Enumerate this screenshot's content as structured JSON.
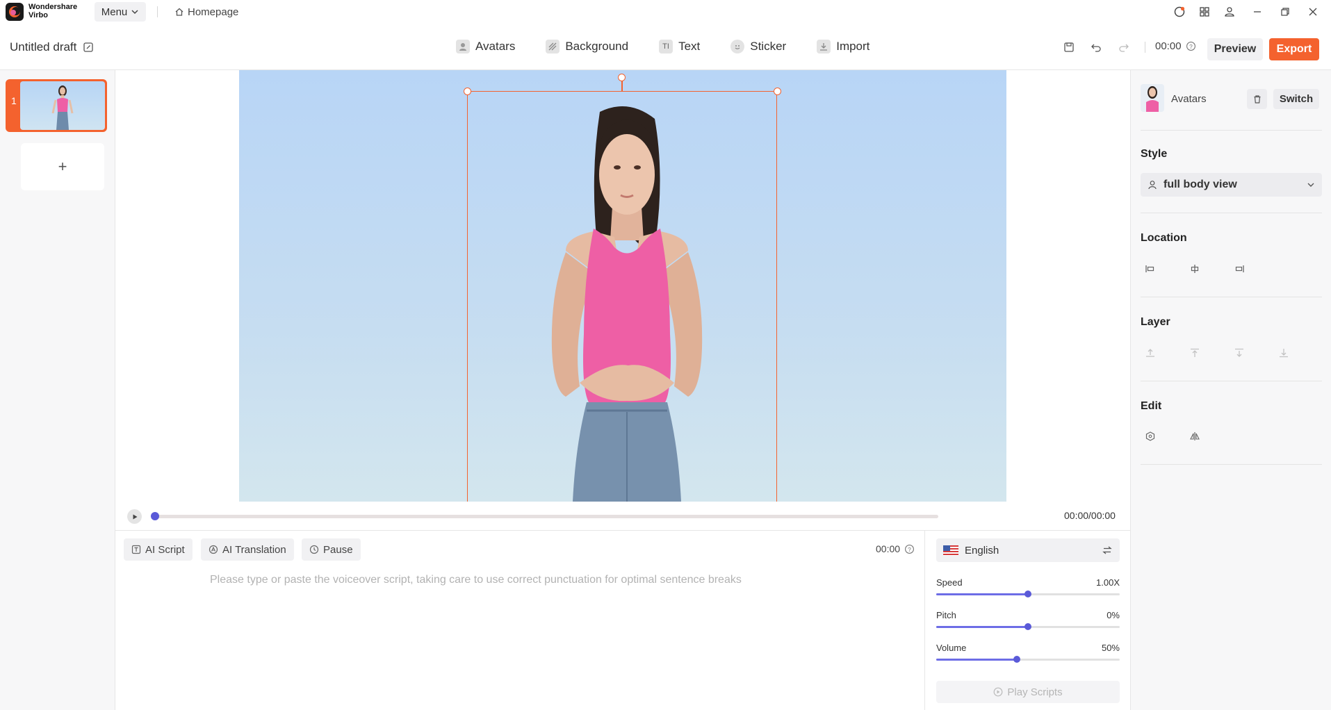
{
  "app": {
    "brand_line1": "Wondershare",
    "brand_line2": "Virbo",
    "menu_label": "Menu",
    "homepage_label": "Homepage"
  },
  "toolbar": {
    "draft_title": "Untitled draft",
    "tools": [
      {
        "label": "Avatars",
        "icon": "avatar-icon"
      },
      {
        "label": "Background",
        "icon": "background-icon"
      },
      {
        "label": "Text",
        "icon": "text-icon",
        "glyph": "TI"
      },
      {
        "label": "Sticker",
        "icon": "sticker-icon"
      },
      {
        "label": "Import",
        "icon": "import-icon"
      }
    ],
    "time": "00:00",
    "preview_label": "Preview",
    "export_label": "Export",
    "accent_color": "#f4622e"
  },
  "scenes": {
    "items": [
      {
        "number": "1",
        "selected": true
      }
    ],
    "add_label": "+"
  },
  "timeline": {
    "time_display": "00:00/00:00",
    "progress": 0
  },
  "script": {
    "ai_script_label": "AI Script",
    "ai_translation_label": "AI Translation",
    "pause_label": "Pause",
    "time": "00:00",
    "placeholder": "Please type or paste the voiceover script, taking care to use correct punctuation for optimal sentence breaks"
  },
  "voice": {
    "language": "English",
    "speed_label": "Speed",
    "speed_value": "1.00X",
    "speed_fraction": 0.5,
    "pitch_label": "Pitch",
    "pitch_value": "0%",
    "pitch_fraction": 0.5,
    "volume_label": "Volume",
    "volume_value": "50%",
    "volume_fraction": 0.44,
    "play_label": "Play Scripts"
  },
  "properties": {
    "header_label": "Avatars",
    "switch_label": "Switch",
    "style_title": "Style",
    "style_value": "full body view",
    "location_title": "Location",
    "layer_title": "Layer",
    "edit_title": "Edit"
  }
}
